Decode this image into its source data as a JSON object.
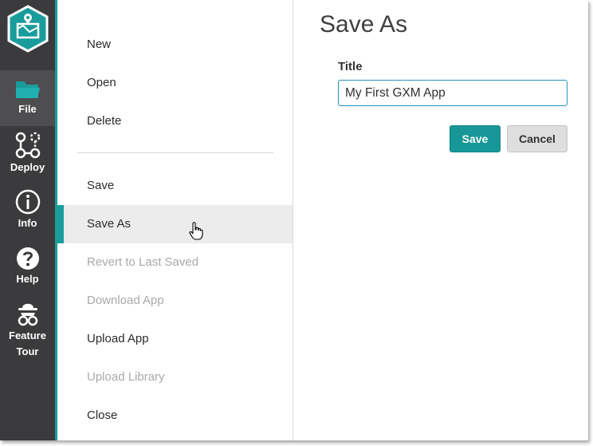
{
  "rail": {
    "items": [
      {
        "label": "File",
        "icon": "folder-icon"
      },
      {
        "label": "Deploy",
        "icon": "deploy-icon"
      },
      {
        "label": "Info",
        "icon": "info-icon"
      },
      {
        "label": "Help",
        "icon": "help-icon"
      },
      {
        "label_line1": "Feature",
        "label_line2": "Tour",
        "icon": "feature-tour-icon"
      }
    ],
    "active": "File"
  },
  "menu": {
    "items": [
      {
        "label": "New",
        "enabled": true
      },
      {
        "label": "Open",
        "enabled": true
      },
      {
        "label": "Delete",
        "enabled": true
      },
      {
        "label": "Save",
        "enabled": true
      },
      {
        "label": "Save As",
        "enabled": true,
        "active": true
      },
      {
        "label": "Revert to Last Saved",
        "enabled": false
      },
      {
        "label": "Download App",
        "enabled": false
      },
      {
        "label": "Upload App",
        "enabled": true
      },
      {
        "label": "Upload Library",
        "enabled": false
      },
      {
        "label": "Close",
        "enabled": true
      }
    ]
  },
  "panel": {
    "heading": "Save As",
    "field_label": "Title",
    "title_value": "My First GXM App",
    "save_label": "Save",
    "cancel_label": "Cancel"
  },
  "colors": {
    "accent": "#1a9c9c",
    "rail_bg": "#3b3b3d",
    "input_border": "#2a8fc0"
  }
}
